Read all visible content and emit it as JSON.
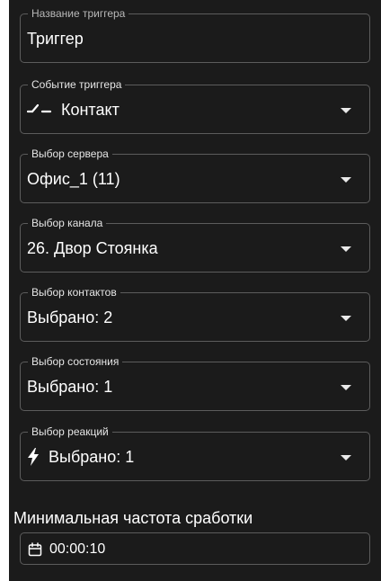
{
  "fields": {
    "trigger_name": {
      "label": "Название триггера",
      "value": "Триггер"
    },
    "trigger_event": {
      "label": "Событие триггера",
      "value": "Контакт",
      "icon": "contact-switch-icon"
    },
    "server": {
      "label": "Выбор сервера",
      "value": "Офис_1 (11)"
    },
    "channel": {
      "label": "Выбор канала",
      "value": "26. Двор Стоянка"
    },
    "contacts": {
      "label": "Выбор контактов",
      "value": "Выбрано: 2"
    },
    "states": {
      "label": "Выбор состояния",
      "value": "Выбрано: 1"
    },
    "reactions": {
      "label": "Выбор реакций",
      "value": "Выбрано: 1",
      "icon": "lightning-icon"
    }
  },
  "min_frequency": {
    "label": "Минимальная частота сработки",
    "value": "00:00:10",
    "icon": "calendar-icon"
  },
  "colors": {
    "background": "#1b1b1b",
    "border": "#5c5c5c",
    "text": "#ffffff"
  }
}
